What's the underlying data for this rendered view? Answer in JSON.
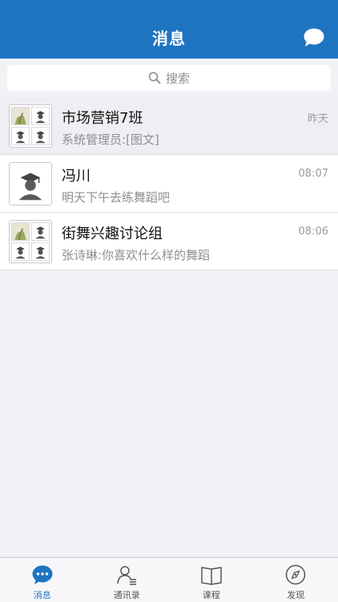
{
  "header": {
    "title": "消息"
  },
  "search": {
    "placeholder": "搜索"
  },
  "conversations": [
    {
      "name": "市场营销7班",
      "preview": "系统管理员:[图文]",
      "time": "昨天",
      "avatar": "group-avatar"
    },
    {
      "name": "冯川",
      "preview": "明天下午去练舞蹈吧",
      "time": "08:07",
      "avatar": "user-avatar"
    },
    {
      "name": "街舞兴趣讨论组",
      "preview": "张诗琳:你喜欢什么样的舞蹈",
      "time": "08:06",
      "avatar": "group-avatar"
    }
  ],
  "tabs": [
    {
      "label": "消息",
      "icon": "chat-bubble-icon",
      "active": true
    },
    {
      "label": "通讯录",
      "icon": "contacts-icon",
      "active": false
    },
    {
      "label": "课程",
      "icon": "book-icon",
      "active": false
    },
    {
      "label": "发现",
      "icon": "compass-icon",
      "active": false
    }
  ],
  "colors": {
    "header": "#1f74c1",
    "accent": "#1f74c1",
    "background": "#f2f2f6"
  }
}
